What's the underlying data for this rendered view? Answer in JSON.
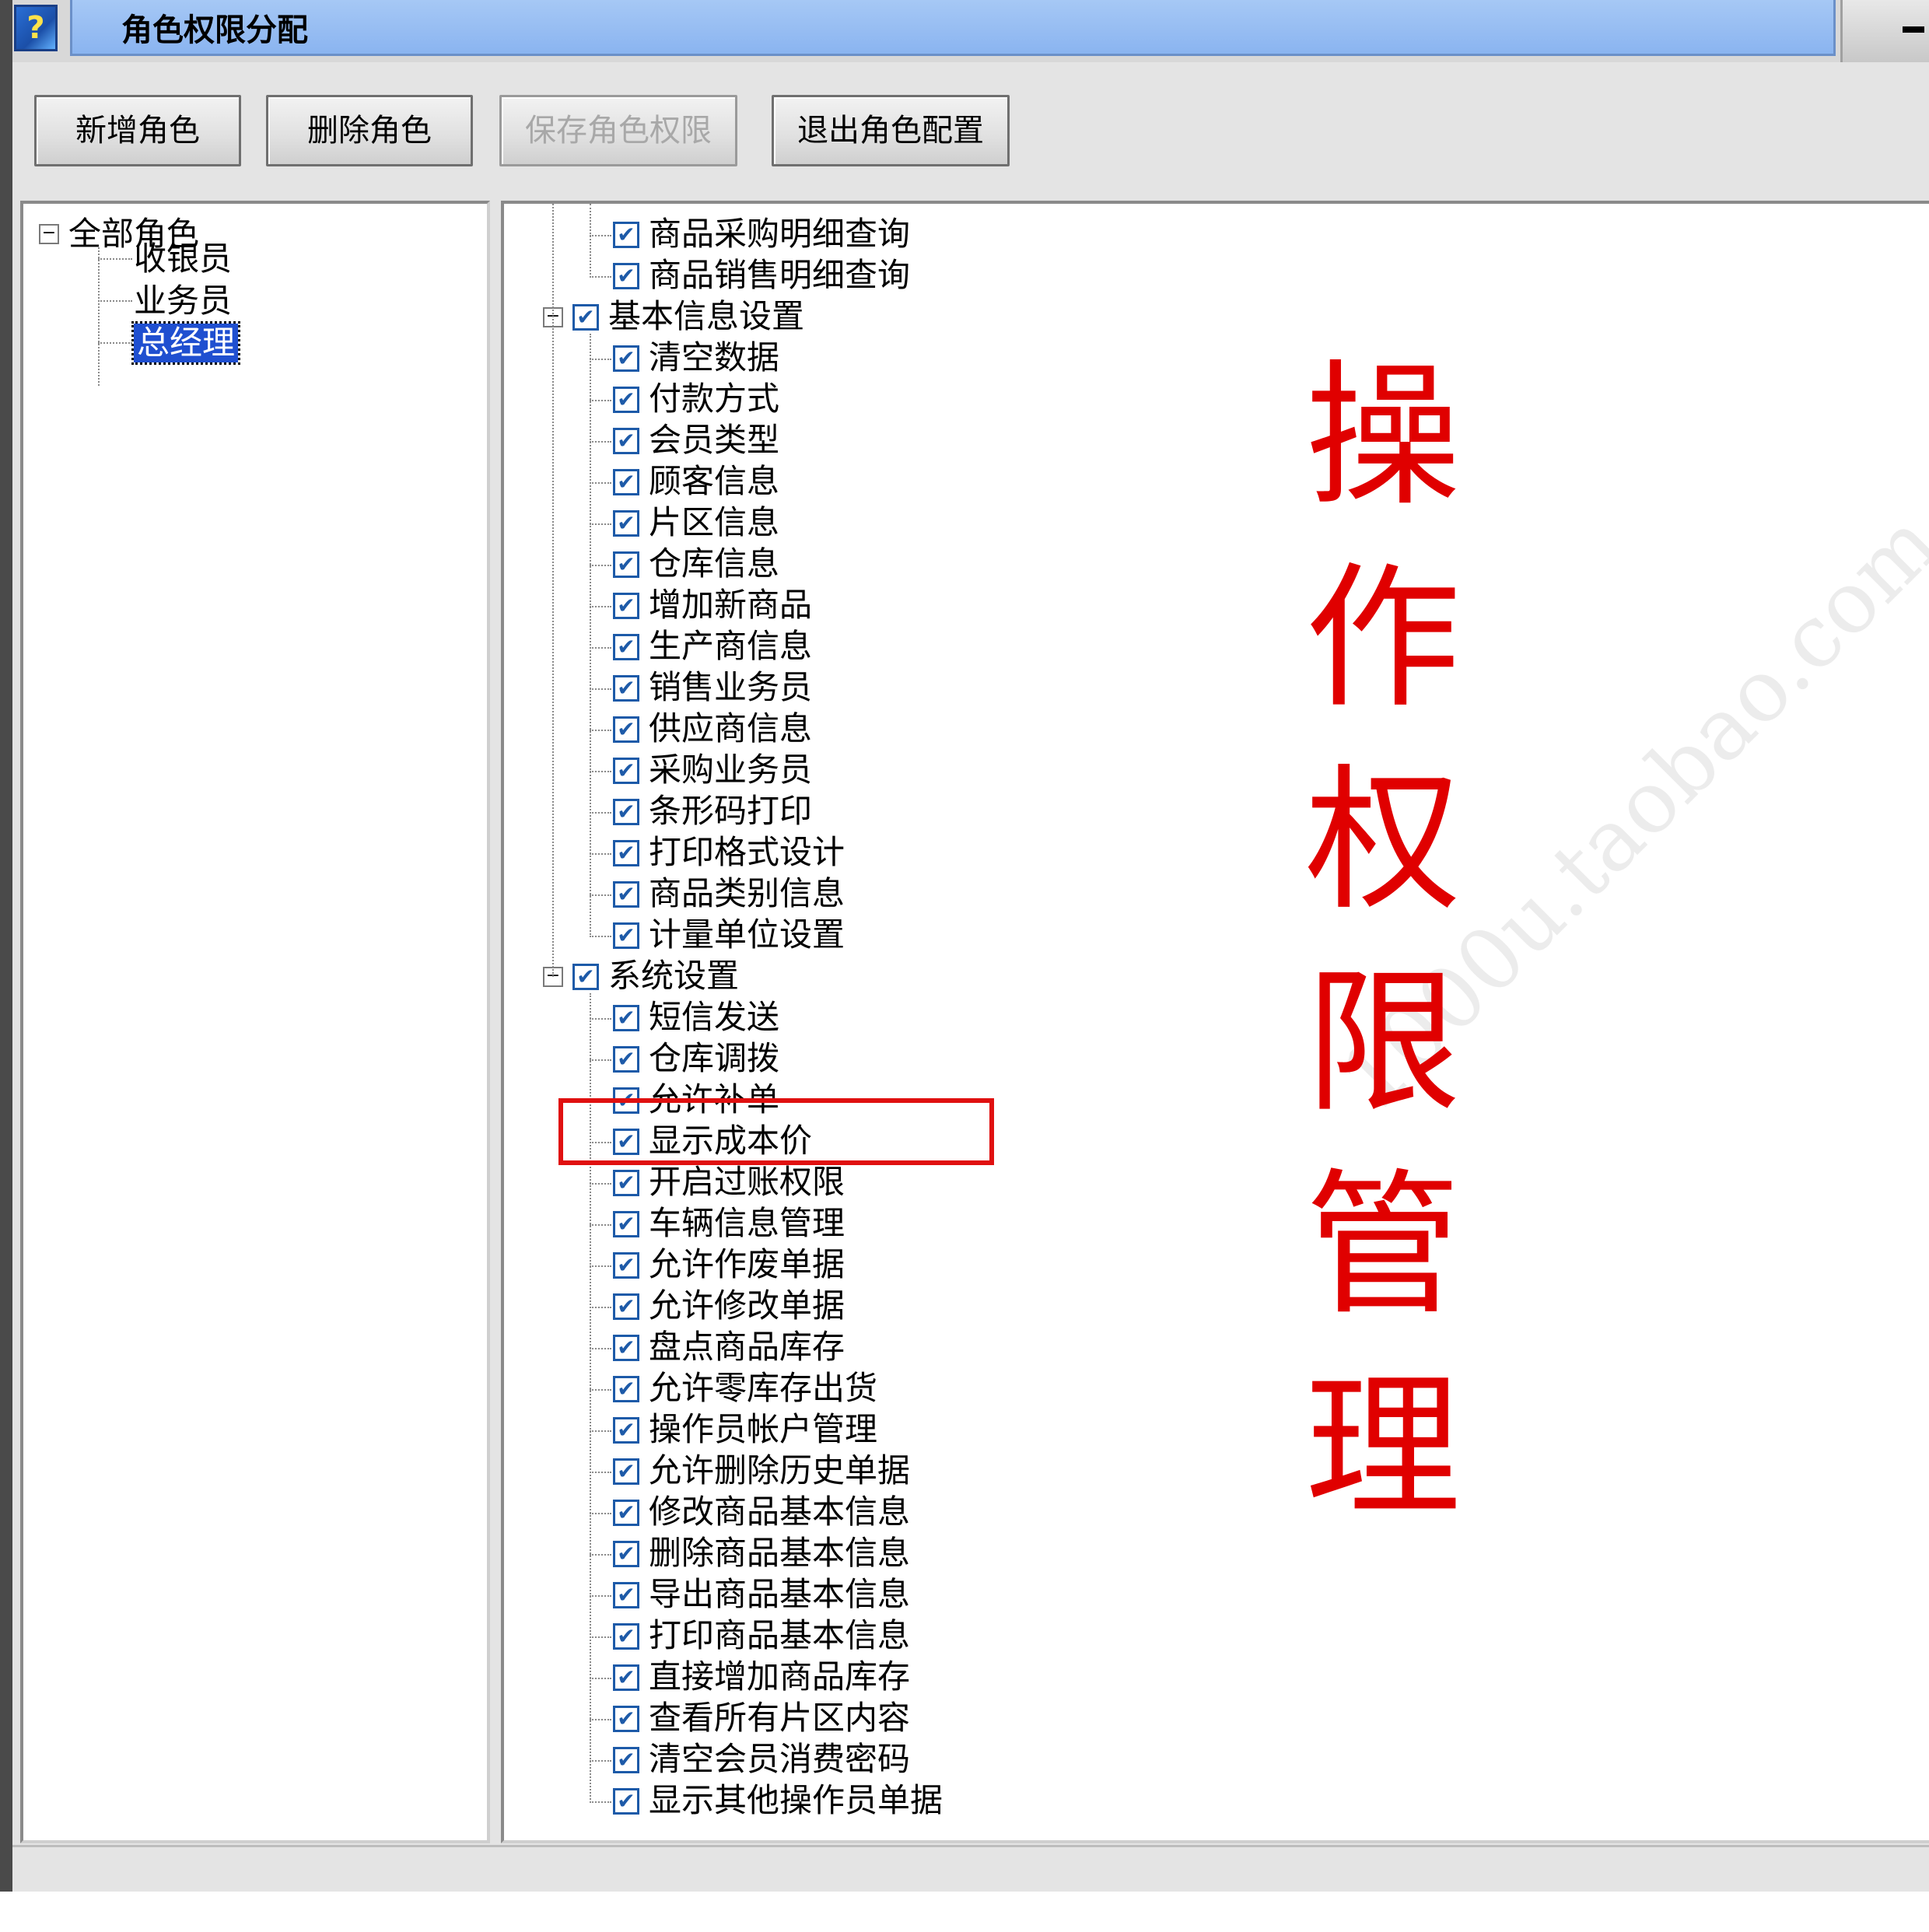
{
  "window": {
    "title": "角色权限分配",
    "app_icon": "app-logo-icon"
  },
  "toolbar": {
    "add_role": "新增角色",
    "delete_role": "删除角色",
    "save_permissions": "保存角色权限",
    "exit_config": "退出角色配置"
  },
  "roles_tree": {
    "root": "全部角色",
    "items": [
      "收银员",
      "业务员",
      "总经理"
    ],
    "selected": "总经理"
  },
  "permissions_tree": {
    "leading_items": [
      "商品采购明细查询",
      "商品销售明细查询"
    ],
    "groups": [
      {
        "label": "基本信息设置",
        "items": [
          "清空数据",
          "付款方式",
          "会员类型",
          "顾客信息",
          "片区信息",
          "仓库信息",
          "增加新商品",
          "生产商信息",
          "销售业务员",
          "供应商信息",
          "采购业务员",
          "条形码打印",
          "打印格式设计",
          "商品类别信息",
          "计量单位设置"
        ]
      },
      {
        "label": "系统设置",
        "items": [
          "短信发送",
          "仓库调拨",
          "允许补单",
          "显示成本价",
          "开启过账权限",
          "车辆信息管理",
          "允许作废单据",
          "允许修改单据",
          "盘点商品库存",
          "允许零库存出货",
          "操作员帐户管理",
          "允许删除历史单据",
          "修改商品基本信息",
          "删除商品基本信息",
          "导出商品基本信息",
          "打印商品基本信息",
          "直接增加商品库存",
          "查看所有片区内容",
          "清空会员消费密码",
          "显示其他操作员单据"
        ]
      }
    ],
    "highlighted_item": "显示成本价",
    "check_mark": "✔"
  },
  "overlay_text": "操作权限管理",
  "watermark": "1000u.taobao.com",
  "colors": {
    "selection": "#1f4fd0",
    "overlay": "#e00000",
    "highlight_box": "#e01010",
    "checkbox": "#1d5aa8"
  }
}
